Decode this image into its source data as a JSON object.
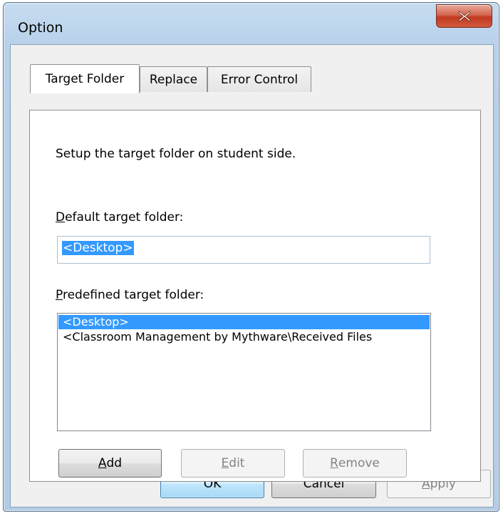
{
  "window": {
    "title": "Option"
  },
  "tabs": [
    {
      "label": "Target Folder",
      "active": true
    },
    {
      "label": "Replace",
      "active": false
    },
    {
      "label": "Error Control",
      "active": false
    }
  ],
  "panel": {
    "description": "Setup the target folder on student side.",
    "default_label_mnemonic": "D",
    "default_label_rest": "efault target folder:",
    "default_value": "<Desktop>",
    "predefined_label_mnemonic": "P",
    "predefined_label_rest": "redefined target folder:",
    "predefined_items": [
      {
        "text": "<Desktop>",
        "selected": true
      },
      {
        "text": "<Classroom Management by Mythware\\Received Files",
        "selected": false
      }
    ]
  },
  "panel_buttons": {
    "add_mnemonic": "A",
    "add_rest": "dd",
    "edit_mnemonic": "E",
    "edit_rest": "dit",
    "remove_mnemonic": "R",
    "remove_rest": "emove"
  },
  "dialog_buttons": {
    "ok": "OK",
    "cancel": "Cancel",
    "apply_mnemonic": "A",
    "apply_rest": "pply"
  },
  "colors": {
    "selection": "#3399ff",
    "close_button": "#c1391f"
  },
  "icons": {
    "close": "close-icon"
  }
}
